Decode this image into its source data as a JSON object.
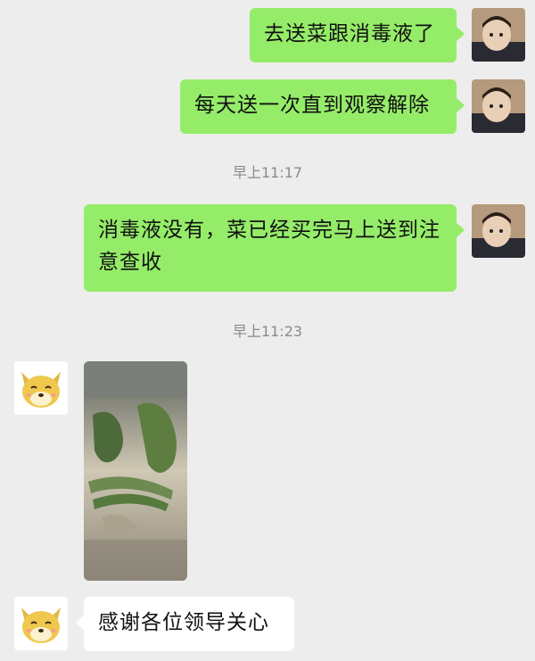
{
  "messages": [
    {
      "type": "sent",
      "text": "去送菜跟消毒液了"
    },
    {
      "type": "sent",
      "text": "每天送一次直到观察解除"
    },
    {
      "type": "timestamp",
      "text": "早上11:17"
    },
    {
      "type": "sent",
      "text": "消毒液没有，菜已经买完马上送到注意查收"
    },
    {
      "type": "timestamp",
      "text": "早上11:23"
    },
    {
      "type": "received_image",
      "content": "photo of green vegetables in plastic bags"
    },
    {
      "type": "received",
      "text": "感谢各位领导关心"
    }
  ],
  "avatars": {
    "self": "child-photo-avatar",
    "contact": "shiba-dog-emoji-avatar"
  },
  "colors": {
    "background": "#ededed",
    "sent_bubble": "#95ec69",
    "received_bubble": "#ffffff",
    "timestamp": "#8a8a8a"
  }
}
